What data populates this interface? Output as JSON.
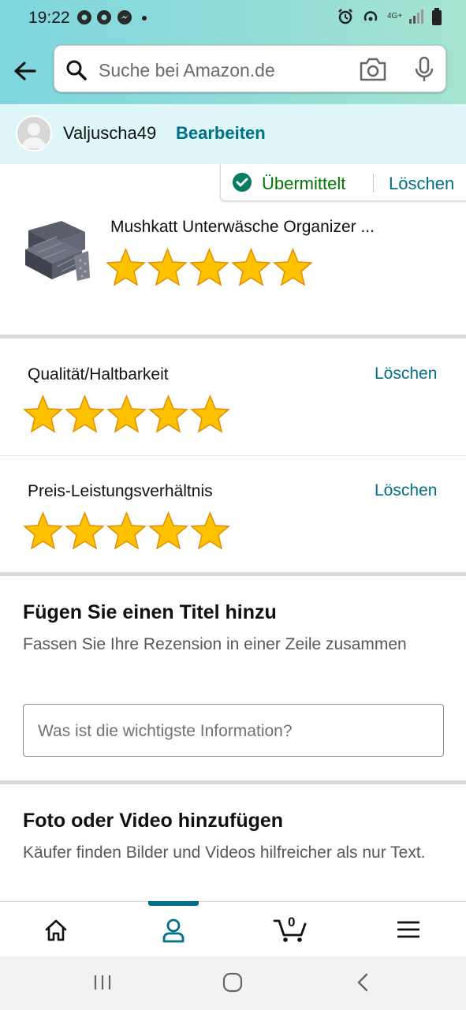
{
  "status_bar": {
    "time": "19:22",
    "network": "4G+"
  },
  "search": {
    "placeholder": "Suche bei Amazon.de"
  },
  "profile": {
    "username": "Valjuscha49",
    "edit_label": "Bearbeiten"
  },
  "submission": {
    "status_label": "Übermittelt",
    "delete_label": "Löschen"
  },
  "product": {
    "name": "Mushkatt Unterwäsche Organizer ...",
    "rating": 5,
    "max_rating": 5
  },
  "ratings": [
    {
      "label": "Qualität/Haltbarkeit",
      "delete_label": "Löschen",
      "rating": 5
    },
    {
      "label": "Preis-Leistungsverhältnis",
      "delete_label": "Löschen",
      "rating": 5
    }
  ],
  "title_section": {
    "heading": "Fügen Sie einen Titel hinzu",
    "subtitle": "Fassen Sie Ihre Rezension in einer Zeile zusammen",
    "input_placeholder": "Was ist die wichtigste Information?"
  },
  "media_section": {
    "heading": "Foto oder Video hinzufügen",
    "subtitle": "Käufer finden Bilder und Videos hilfreicher als nur Text."
  },
  "bottom_nav": {
    "cart_count": "0",
    "active_tab": "profile"
  },
  "colors": {
    "link": "#007185",
    "success": "#007600",
    "star": "#ffa41c",
    "header_gradient": [
      "#7fd6de",
      "#a6e3d0"
    ],
    "profile_bar": "#def6f8"
  }
}
